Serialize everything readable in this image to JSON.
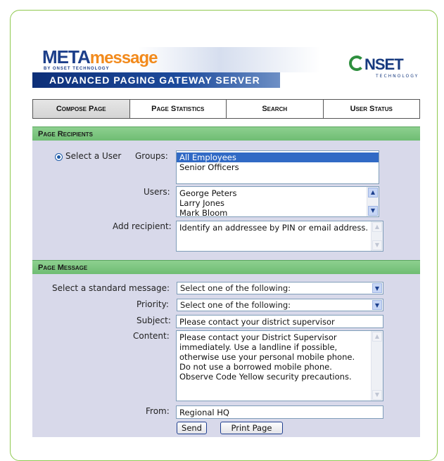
{
  "header": {
    "logo_meta_bold": "META",
    "logo_meta_light": "message",
    "logo_sub": "BY ONSET TECHNOLOGY",
    "product_title": "ADVANCED PAGING GATEWAY SERVER",
    "brand_word": "NSET",
    "brand_sub": "TECHNOLOGY"
  },
  "tabs": [
    {
      "label": "Compose Page",
      "active": true
    },
    {
      "label": "Page Statistics",
      "active": false
    },
    {
      "label": "Search",
      "active": false
    },
    {
      "label": "User Status",
      "active": false
    }
  ],
  "recipients": {
    "section_title": "Page Recipients",
    "select_user_label": "Select a User",
    "groups_label": "Groups:",
    "groups": [
      {
        "name": "All Employees",
        "selected": true
      },
      {
        "name": "Senior Officers",
        "selected": false
      }
    ],
    "users_label": "Users:",
    "users": [
      "George Peters",
      "Larry Jones",
      "Mark Bloom"
    ],
    "add_label": "Add recipient:",
    "add_placeholder": "Identify an addressee by PIN or email address."
  },
  "message": {
    "section_title": "Page Message",
    "standard_label": "Select a standard message:",
    "standard_value": "Select one of the following:",
    "priority_label": "Priority:",
    "priority_value": "Select one of the following:",
    "subject_label": "Subject:",
    "subject_value": "Please contact your district supervisor",
    "content_label": "Content:",
    "content_value": "Please contact your District Supervisor immediately. Use a landline if possible, otherwise use your personal mobile phone. Do not use a borrowed mobile phone. Observe Code Yellow security precautions.",
    "from_label": "From:",
    "from_value": "Regional HQ",
    "send_label": "Send",
    "print_label": "Print Page"
  }
}
